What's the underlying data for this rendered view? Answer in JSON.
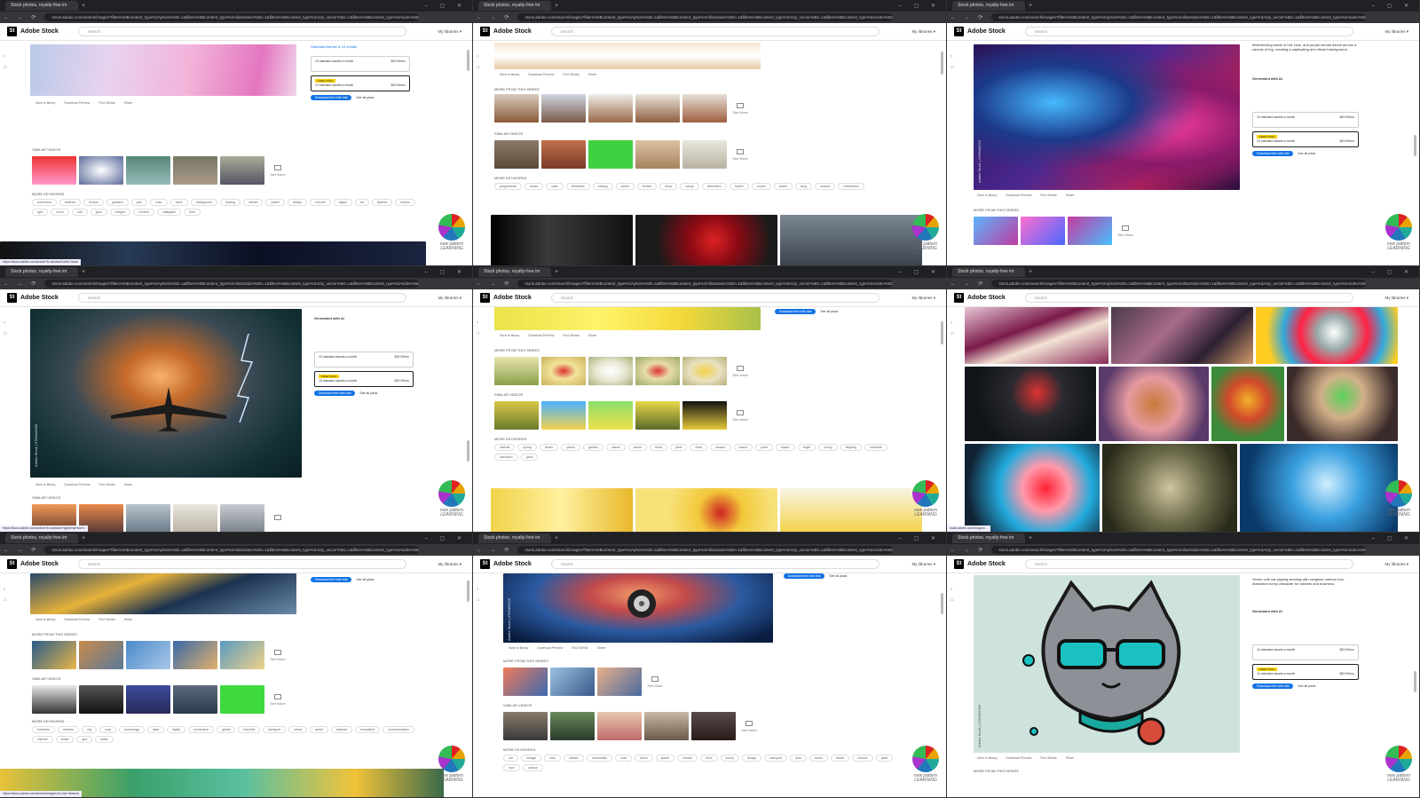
{
  "browser": {
    "tab_title": "Stock photos, royalty-free im",
    "url": "stock.adobe.com/search/images?filters%5Bcontent_type%3Aphoto%5D=1&filters%5Bcontent_type%3Aillustration%5D=1&filters%5Bcontent_type%3Azip_vector%5D=1&filters%5Bcontent_type%3Avideo%5D=1",
    "tab_plus": "+",
    "nav_icons": "← → ⟳",
    "window_controls": "– ▢ ✕"
  },
  "site": {
    "logo": "St",
    "name": "Adobe Stock",
    "search_placeholder": "Search",
    "menu": "My libraries ▾"
  },
  "common": {
    "label_same_series": "More from this series",
    "label_similar": "Similar videos",
    "label_keywords": "More keywords",
    "see_more": "See More",
    "download_btn": "Download free with trial",
    "see_plans": "See all plans",
    "standard_opt": "Standard license & 10 credits",
    "annual_opt": "10 standard assets a month",
    "badge": "FREE TRIAL",
    "price1": "$29.99/mo",
    "price2": "$29.99/mo",
    "action_save": "Save to library",
    "action_preview": "Download Preview",
    "action_visual": "Find Similar",
    "action_share": "Share",
    "watermark": "new pattern LEARNING"
  },
  "panels": [
    {
      "keywords": [
        "panorama",
        "abstract",
        "texture",
        "gradient",
        "pink",
        "color",
        "wave",
        "background",
        "flowing",
        "vibrant",
        "pastel",
        "design",
        "smooth",
        "digital",
        "art",
        "layered",
        "motion",
        "light",
        "curve",
        "soft",
        "glow",
        "elegant",
        "modern",
        "wallpaper",
        "fluid"
      ],
      "status": "https://stock.adobe.com/search?k=abstract+pink+wave"
    },
    {
      "keywords": [
        "gingerbread",
        "house",
        "cake",
        "christmas",
        "holiday",
        "winter",
        "festive",
        "snow",
        "candy",
        "decoration",
        "baked",
        "cookie",
        "sweet",
        "icing",
        "season",
        "celebration"
      ],
      "status": ""
    },
    {
      "description": "Mesmerizing swirls of red, blue, and purple smoke dance across a canvas of fog, creating a captivating and vibrant background.",
      "generated": "Generated with AI",
      "vertical": "Adobe Stock | #789449212",
      "keywords": [],
      "status": ""
    },
    {
      "generated": "Generated with AI",
      "vertical": "Adobe Stock | #789444665",
      "keywords": [],
      "status": "https://stock.adobe.com/search?k=airplane+lightning+storm"
    },
    {
      "keywords": [
        "daffodil",
        "spring",
        "flower",
        "yellow",
        "garden",
        "nature",
        "bloom",
        "floral",
        "petal",
        "fresh",
        "season",
        "macro",
        "plant",
        "easter",
        "bright",
        "sunny",
        "ladybug",
        "botanical",
        "narcissus",
        "grow"
      ],
      "status": ""
    },
    {
      "keywords": [],
      "status": "stock.adobe.com/images/..."
    },
    {
      "keywords": [
        "business",
        "network",
        "city",
        "map",
        "technology",
        "data",
        "digital",
        "connection",
        "global",
        "futuristic",
        "transport",
        "urban",
        "aerial",
        "abstract",
        "innovation",
        "communication",
        "internet",
        "smart",
        "grid",
        "traffic"
      ],
      "status": "https://stock.adobe.com/search/images?k=city+network"
    },
    {
      "vertical": "Adobe Stock | #789462215",
      "keywords": [
        "car",
        "vintage",
        "retro",
        "classic",
        "automobile",
        "road",
        "travel",
        "speed",
        "vehicle",
        "drive",
        "luxury",
        "design",
        "transport",
        "auto",
        "motor",
        "wheel",
        "chrome",
        "paint",
        "race",
        "custom"
      ],
      "status": ""
    },
    {
      "description": "Vector cute cat playing wearing with sunglass cartoon icon illustration funny character for stickers and business",
      "generated": "Generated with AI",
      "vertical": "Adobe Stock | #789352964",
      "keywords": [],
      "status": ""
    }
  ]
}
